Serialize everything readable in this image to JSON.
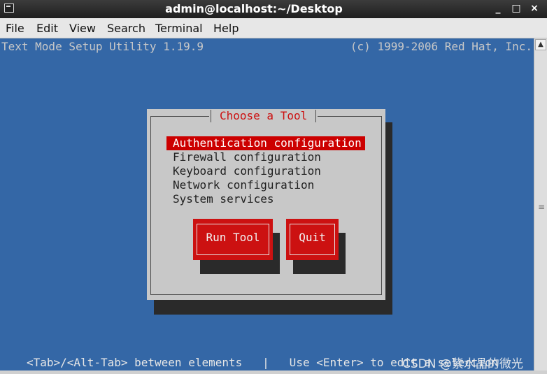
{
  "window": {
    "title": "admin@localhost:~/Desktop",
    "minimize": "_",
    "maximize": "□",
    "close": "×"
  },
  "menubar": [
    "File",
    "Edit",
    "View",
    "Search",
    "Terminal",
    "Help"
  ],
  "terminal": {
    "header_left": "Text Mode Setup Utility 1.19.9",
    "header_right": "(c) 1999-2006 Red Hat, Inc.",
    "dialog_title": "Choose a Tool",
    "items": [
      "Authentication configuration",
      "Firewall configuration",
      "Keyboard configuration",
      "Network configuration",
      "System services"
    ],
    "selected_index": 0,
    "buttons": {
      "run": "Run Tool",
      "quit": "Quit"
    },
    "footer": "<Tab>/<Alt-Tab> between elements   |   Use <Enter> to edit a selection"
  },
  "watermark": "CSDN @紫水晶的微光",
  "colors": {
    "terminal_bg": "#3467a6",
    "dialog_bg": "#c8c8c8",
    "accent_red": "#cc1111"
  },
  "icons": [
    "terminal-icon",
    "minimize-icon",
    "maximize-icon",
    "close-icon",
    "scroll-up-arrow-icon",
    "scroll-grip-icon"
  ]
}
